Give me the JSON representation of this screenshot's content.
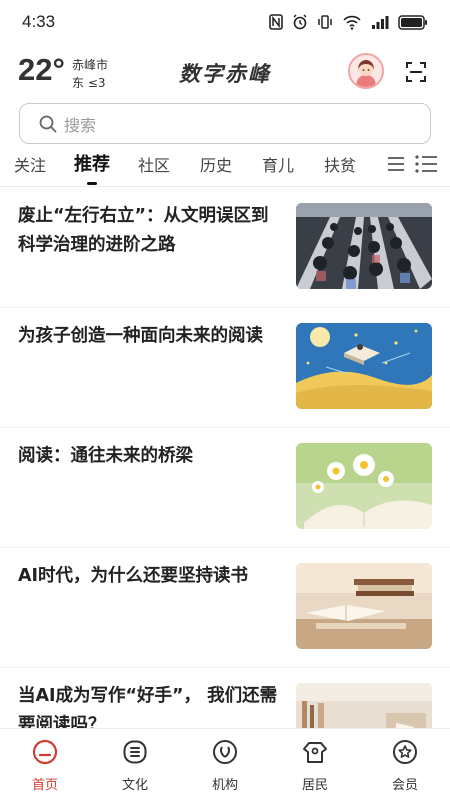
{
  "status_bar": {
    "time": "4:33",
    "icons": [
      "nfc-icon",
      "alarm-icon",
      "vibrate-icon",
      "wifi-6-icon",
      "signal-icon",
      "battery-icon"
    ]
  },
  "header": {
    "temperature": "22°",
    "city": "赤峰市",
    "wind": "东  ≤3",
    "app_title": "数字赤峰"
  },
  "search": {
    "placeholder": "搜索"
  },
  "tabs": {
    "items": [
      {
        "label": "关注"
      },
      {
        "label": "推荐"
      },
      {
        "label": "社区"
      },
      {
        "label": "历史"
      },
      {
        "label": "育儿"
      },
      {
        "label": "扶贫"
      }
    ],
    "active": "推荐"
  },
  "feed": [
    {
      "title": "废止“左行右立”：从文明误区到科学治理的进阶之路",
      "image": "escalator-crowd-photo"
    },
    {
      "title": "为孩子创造一种面向未来的阅读",
      "image": "child-reading-illustration"
    },
    {
      "title": "阅读：通往未来的桥梁",
      "image": "daisies-open-book-photo"
    },
    {
      "title": "AI时代，为什么还要坚持读书",
      "image": "books-on-table-photo"
    },
    {
      "title": "当AI成为写作“好手”， 我们还需要阅读吗？",
      "image": "bookshelf-photo"
    }
  ],
  "bottom_nav": {
    "items": [
      {
        "label": "首页",
        "icon": "home-icon"
      },
      {
        "label": "文化",
        "icon": "culture-icon"
      },
      {
        "label": "机构",
        "icon": "institution-icon"
      },
      {
        "label": "居民",
        "icon": "resident-icon"
      },
      {
        "label": "会员",
        "icon": "member-icon"
      }
    ],
    "active": "首页",
    "active_color": "#d23a2f"
  }
}
